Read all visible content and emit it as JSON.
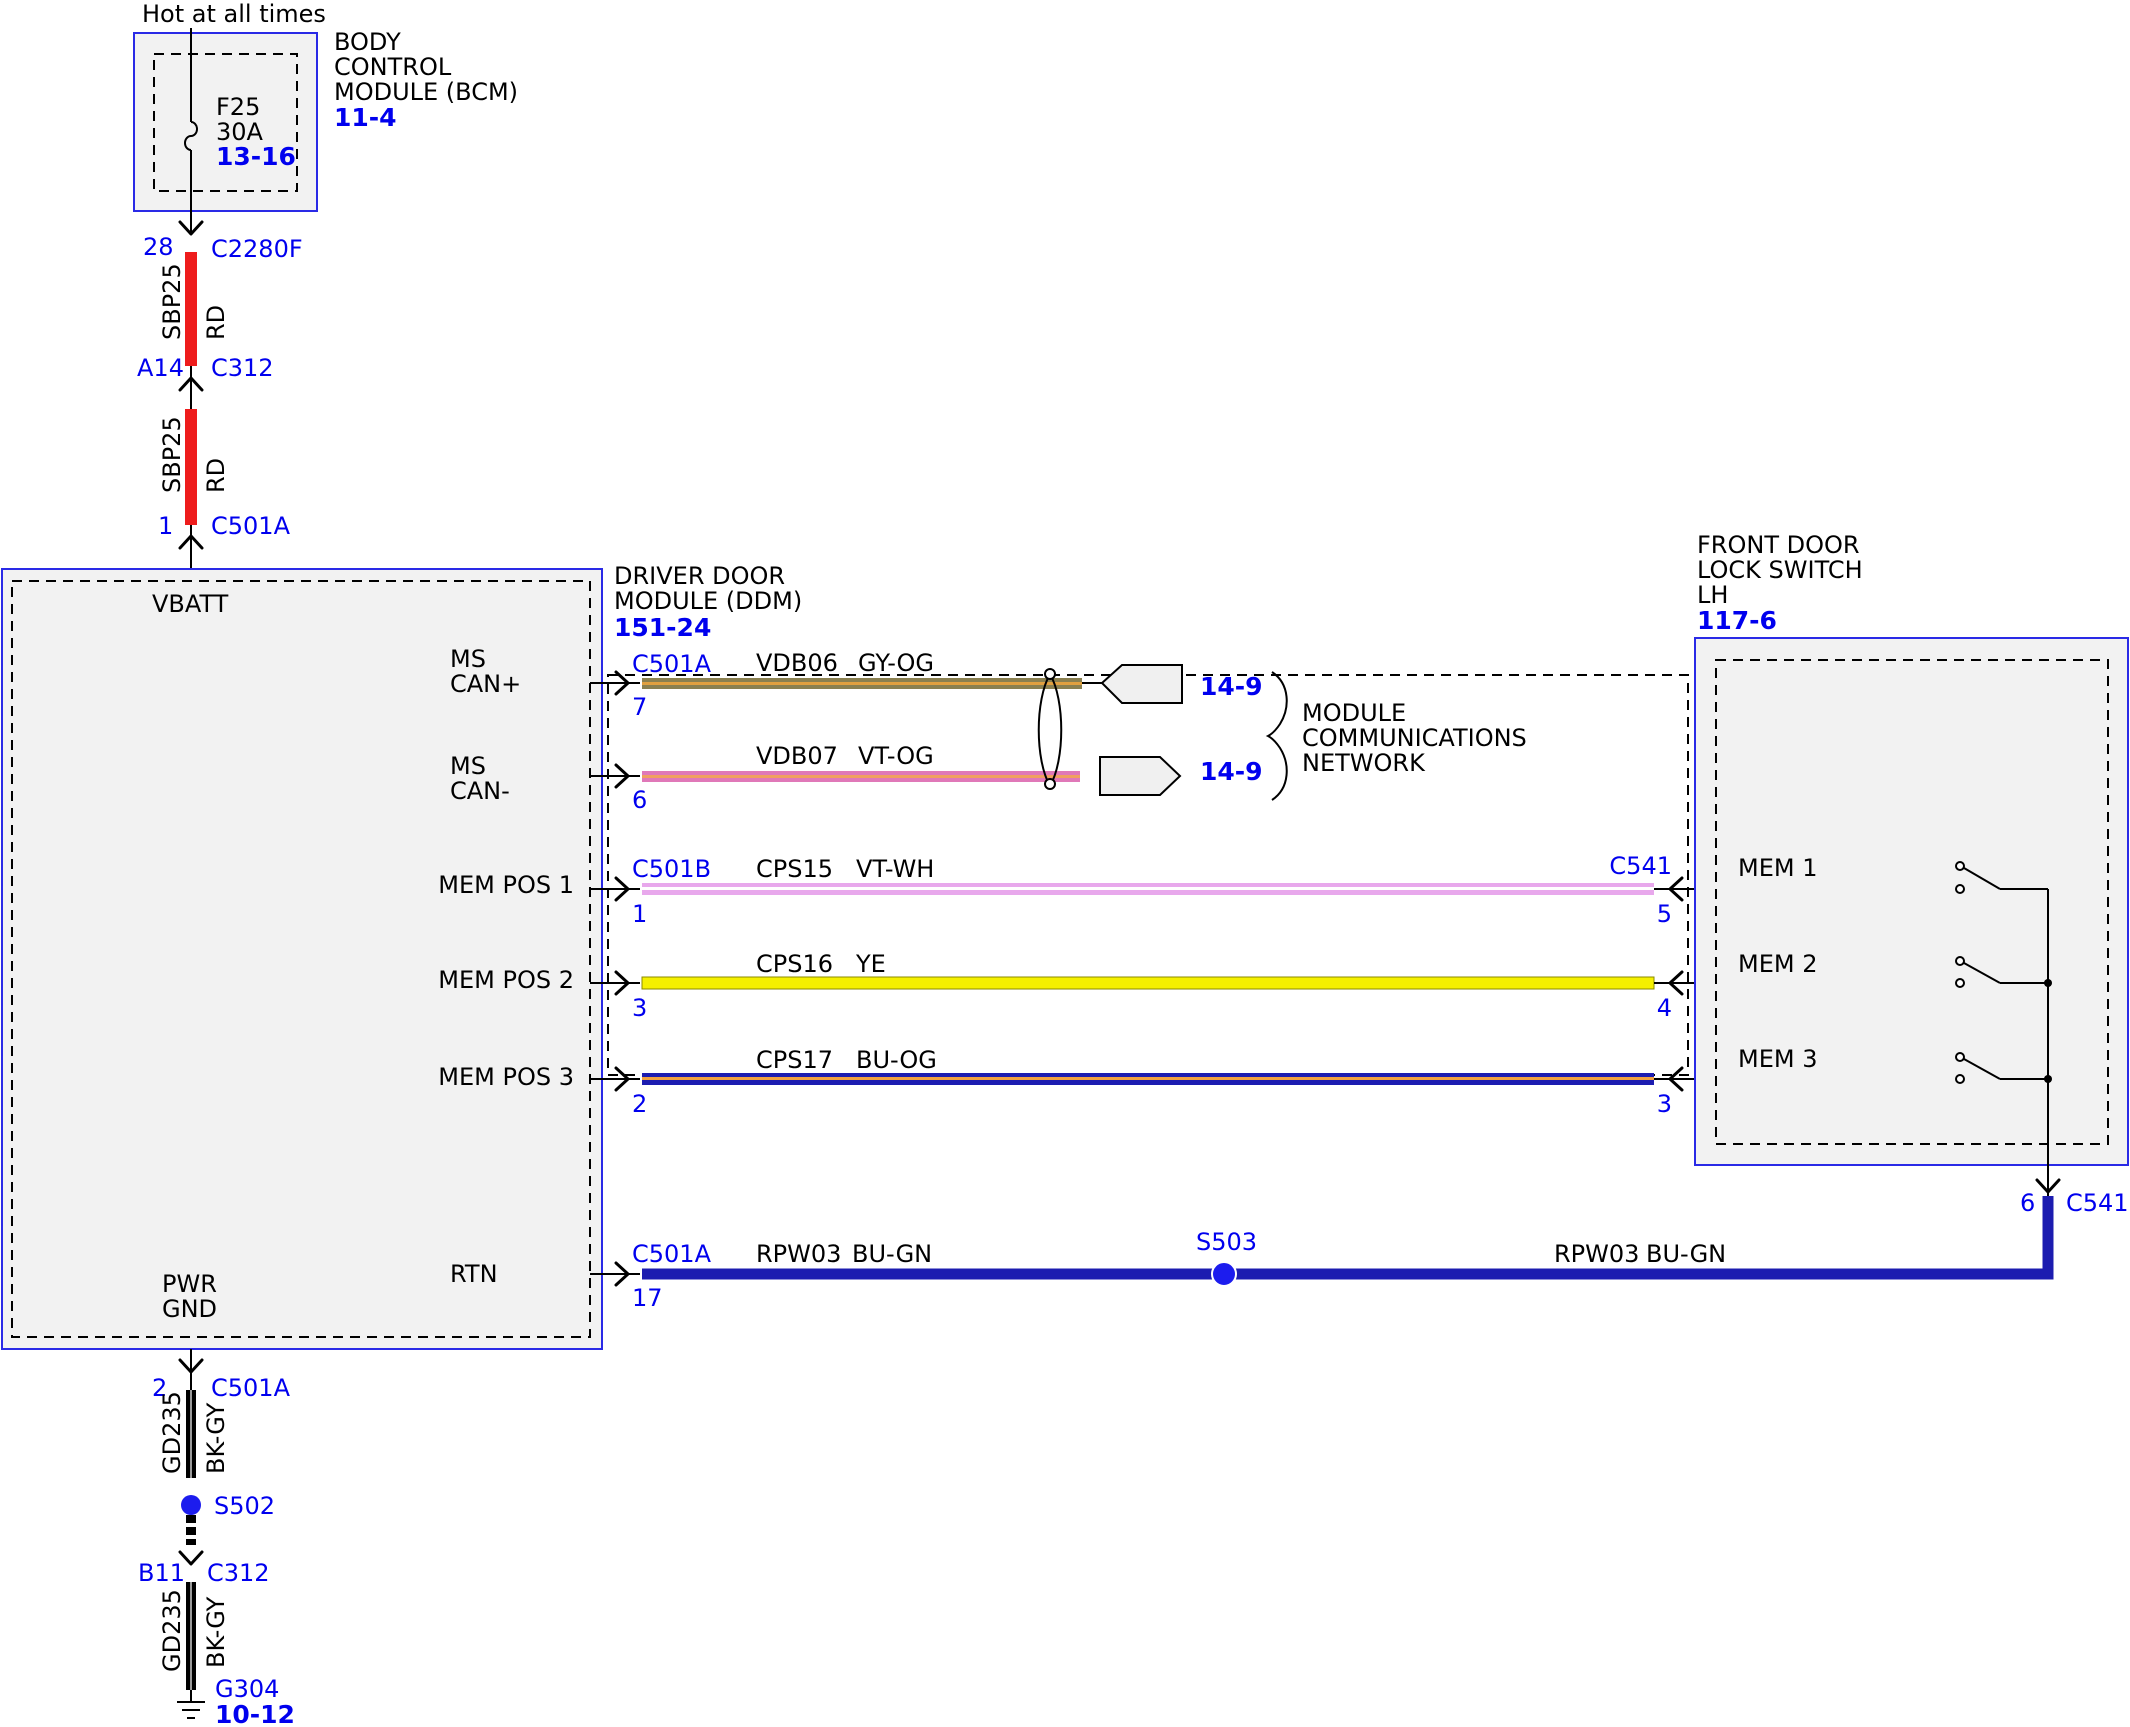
{
  "bcm": {
    "power_label": "Hot at all times",
    "name_line1": "BODY",
    "name_line2": "CONTROL",
    "name_line3": "MODULE (BCM)",
    "ref": "11-4",
    "fuse_id": "F25",
    "fuse_rating": "30A",
    "fuse_ref": "13-16"
  },
  "power_feed": {
    "bcm_pin": "28",
    "bcm_connector": "C2280F",
    "circuit_upper": "SBP25",
    "color_upper": "RD",
    "inline_pin": "A14",
    "inline_connector": "C312",
    "circuit_lower": "SBP25",
    "color_lower": "RD",
    "ddm_pin": "1",
    "ddm_connector": "C501A",
    "wire_color": "#ee1c1c"
  },
  "ddm": {
    "name_line1": "DRIVER DOOR",
    "name_line2": "MODULE (DDM)",
    "ref": "151-24",
    "vbatt_label": "VBATT",
    "pwr_gnd_line1": "PWR",
    "pwr_gnd_line2": "GND",
    "pins": {
      "ms_can_plus_line1": "MS",
      "ms_can_plus_line2": "CAN+",
      "ms_can_minus_line1": "MS",
      "ms_can_minus_line2": "CAN-",
      "mem_pos_1": "MEM POS 1",
      "mem_pos_2": "MEM POS 2",
      "mem_pos_3": "MEM POS 3",
      "rtn": "RTN"
    }
  },
  "can_network": {
    "can_plus": {
      "connector": "C501A",
      "pin": "7",
      "circuit": "VDB06",
      "color": "GY-OG",
      "ref": "14-9"
    },
    "can_minus": {
      "pin": "6",
      "circuit": "VDB07",
      "color": "VT-OG",
      "ref": "14-9"
    },
    "label_line1": "MODULE",
    "label_line2": "COMMUNICATIONS",
    "label_line3": "NETWORK"
  },
  "mem_circuits": {
    "ddm_connector": "C501B",
    "switch_connector": "C541",
    "mem1": {
      "ddm_pin": "1",
      "circuit": "CPS15",
      "color": "VT-WH",
      "switch_pin": "5"
    },
    "mem2": {
      "ddm_pin": "3",
      "circuit": "CPS16",
      "color": "YE",
      "switch_pin": "4"
    },
    "mem3": {
      "ddm_pin": "2",
      "circuit": "CPS17",
      "color": "BU-OG",
      "switch_pin": "3"
    }
  },
  "switch": {
    "name_line1": "FRONT DOOR",
    "name_line2": "LOCK SWITCH",
    "name_line3": "LH",
    "ref": "117-6",
    "mem1_label": "MEM 1",
    "mem2_label": "MEM 2",
    "mem3_label": "MEM 3",
    "common_pin": "6",
    "common_connector": "C541"
  },
  "rtn_circuit": {
    "ddm_connector": "C501A",
    "ddm_pin": "17",
    "circuit_left": "RPW03",
    "color_left": "BU-GN",
    "splice": "S503",
    "circuit_right": "RPW03",
    "color_right": "BU-GN"
  },
  "ground": {
    "ddm_pin": "2",
    "ddm_connector": "C501A",
    "circuit_upper": "GD235",
    "color_upper": "BK-GY",
    "splice": "S502",
    "inline_pin": "B11",
    "inline_connector": "C312",
    "circuit_lower": "GD235",
    "color_lower": "BK-GY",
    "ground_point": "G304",
    "ground_ref": "10-12"
  },
  "colors": {
    "module_border": "#2a2ae6",
    "module_fill": "#f2f2f2",
    "label_blue": "#0000ee",
    "red_wire": "#ee1c1c",
    "blue_wire": "#1c1cb0",
    "yellow_wire": "#f5f000",
    "violet_white_wire": "#e8a8ec",
    "violet_orange_wire": "#e078b8",
    "gray_orange_wire": "#8a8050"
  }
}
